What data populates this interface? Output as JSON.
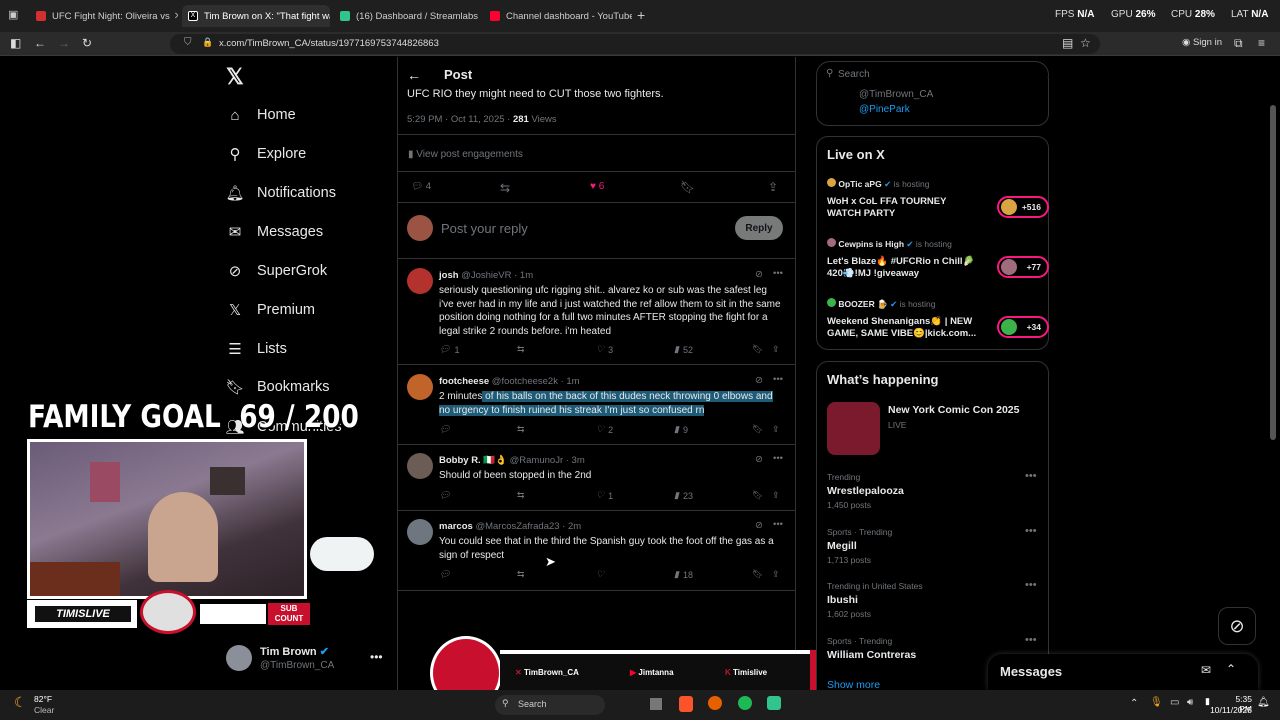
{
  "browser": {
    "tabs": [
      {
        "title": "UFC Fight Night: Oliveira vs",
        "color": "#d32f2f"
      },
      {
        "title": "Tim Brown on X: \"That fight wa",
        "color": "#ffffff"
      },
      {
        "title": "(16) Dashboard / Streamlabs",
        "color": "#31c48d"
      },
      {
        "title": "Channel dashboard - YouTube S",
        "color": "#ff0033"
      }
    ],
    "stats": {
      "fps_label": "FPS",
      "fps_value": "N/A",
      "gpu_label": "GPU",
      "gpu_value": "26",
      "cpu_label": "CPU",
      "cpu_value": "28",
      "lat_label": "LAT",
      "lat_value": "N/A",
      "pct": "%"
    },
    "url": "x.com/TimBrown_CA/status/1977169753744826863",
    "signin": "Sign in"
  },
  "sidebar": {
    "items": [
      {
        "label": "Home",
        "icon": "home-icon"
      },
      {
        "label": "Explore",
        "icon": "search-icon"
      },
      {
        "label": "Notifications",
        "icon": "bell-icon"
      },
      {
        "label": "Messages",
        "icon": "mail-icon"
      },
      {
        "label": "SuperGrok",
        "icon": "grok-icon"
      },
      {
        "label": "Premium",
        "icon": "x-logo-icon"
      },
      {
        "label": "Lists",
        "icon": "list-icon"
      },
      {
        "label": "Bookmarks",
        "icon": "bookmark-icon"
      },
      {
        "label": "Communities",
        "icon": "people-icon"
      }
    ],
    "profile": {
      "name": "Tim Brown",
      "handle": "@TimBrown_CA"
    }
  },
  "post": {
    "header": "Post",
    "text_tail": "UFC RIO they might need to CUT those two fighters.",
    "time": "5:29 PM · Oct 11, 2025 ·",
    "views_count": "281",
    "views_label": "Views",
    "engagements": "View post engagements",
    "replies": "4",
    "likes": "6",
    "reply_placeholder": "Post your reply",
    "reply_button": "Reply"
  },
  "replies": [
    {
      "name": "josh",
      "handle": "@JoshieVR · 1m",
      "text": "seriously questioning ufc rigging shit.. alvarez ko or sub was the safest leg i've ever had in my life and i just watched the ref allow them to sit in the same position doing nothing for a full two minutes AFTER stopping the fight for a legal strike 2 rounds before. i'm heated",
      "comments": "1",
      "likes": "3",
      "views": "52",
      "avatar": "#b3322e"
    },
    {
      "name": "footcheese",
      "handle": "@footcheese2k · 1m",
      "text_a": "2 minutes",
      "text_b": " of his balls on the back of this dudes neck throwing 0 elbows and no urgency to finish ruined his streak I'm just so confused rn",
      "comments": "",
      "likes": "2",
      "views": "9",
      "avatar": "#c0642a"
    },
    {
      "name": "Bobby R. 🇮🇹👌",
      "handle": "@RamunoJr · 3m",
      "text": "Should of been stopped in the 2nd",
      "comments": "",
      "likes": "1",
      "views": "23",
      "avatar": "#6b5c55"
    },
    {
      "name": "marcos",
      "handle": "@MarcosZafrada23 · 2m",
      "text": "You could see that in the third the Spanish guy took the foot off the gas as a sign of respect",
      "comments": "",
      "likes": "",
      "views": "18",
      "avatar": "#6e7780"
    }
  ],
  "right": {
    "search_placeholder": "Search",
    "profile_card": {
      "handle": "@TimBrown_CA",
      "location": "@PinePark"
    },
    "live": {
      "title": "Live on X",
      "hosting": "is hosting",
      "items": [
        {
          "host": "OpTic aPG",
          "title": "WoH x CoL FFA TOURNEY WATCH PARTY",
          "count": "+516"
        },
        {
          "host": "Cewpins is High",
          "title": "Let's Blaze🔥 #UFCRio n Chill🥬 420💨!MJ !giveaway",
          "count": "+77"
        },
        {
          "host": "BOOZER 🍺",
          "title": "Weekend Shenanigans👏 | NEW GAME, SAME VIBE😊|kick.com...",
          "count": "+34"
        }
      ]
    },
    "happening": {
      "title": "What’s happening",
      "featured": {
        "title": "New York Comic Con 2025",
        "sub": "LIVE"
      },
      "trends": [
        {
          "context": "Trending",
          "name": "Wrestlepalooza",
          "posts": "1,450 posts"
        },
        {
          "context": "Sports · Trending",
          "name": "Megill",
          "posts": "1,713 posts"
        },
        {
          "context": "Trending in United States",
          "name": "Ibushi",
          "posts": "1,602 posts"
        },
        {
          "context": "Sports · Trending",
          "name": "William Contreras",
          "posts": ""
        }
      ],
      "show_more": "Show more"
    },
    "messages": "Messages"
  },
  "overlay": {
    "goal_label": "FAMILY GOAL",
    "goal_value": "69 / 200",
    "brand": "TIMISLIVE",
    "sub_top": "SUB",
    "sub_bottom": "COUNT",
    "socials": [
      "TimBrown_CA",
      "Jimtanna",
      "Timislive"
    ]
  },
  "taskbar": {
    "temp": "82°F",
    "weather": "Clear",
    "search": "Search",
    "time": "5:35 PM",
    "date": "10/11/2025"
  }
}
